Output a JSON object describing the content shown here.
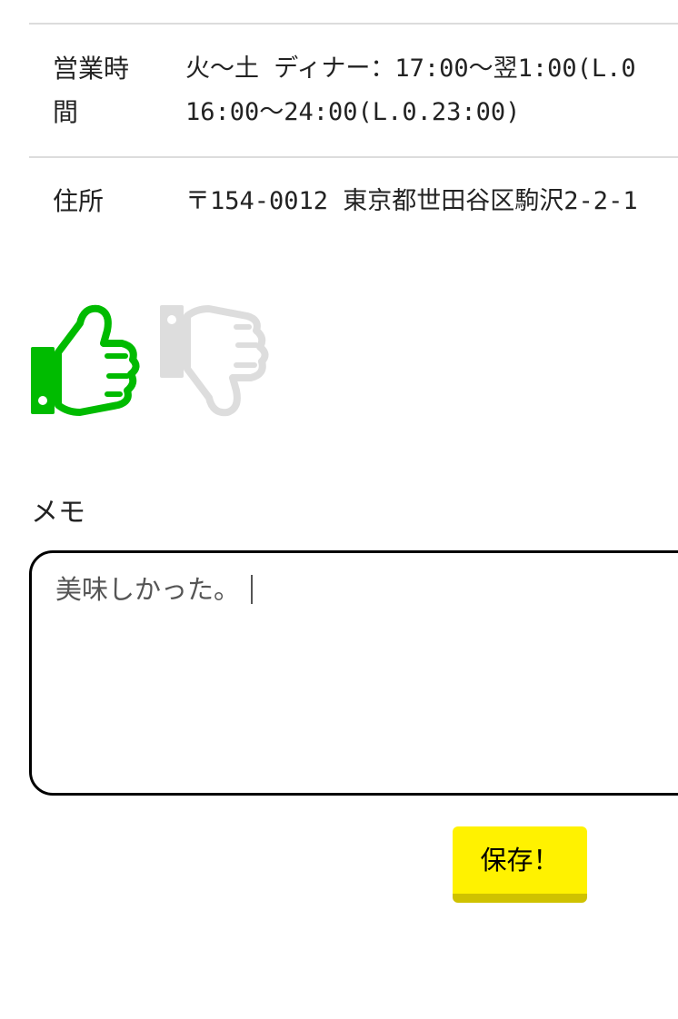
{
  "info": {
    "hours": {
      "label": "営業時間",
      "line1": "火〜土 ディナー：17:00〜翌1:00(L.0",
      "line2": "16:00〜24:00(L.0.23:00)"
    },
    "address": {
      "label": "住所",
      "value": "〒154-0012 東京都世田谷区駒沢2-2-1"
    }
  },
  "rating": {
    "like_icon": "thumbs-up-icon",
    "dislike_icon": "thumbs-down-icon",
    "like_color": "#00bb00",
    "dislike_color": "#dddddd",
    "selected": "like"
  },
  "memo": {
    "label": "メモ",
    "value": "美味しかった。"
  },
  "save": {
    "label": "保存！",
    "color": "#fff200"
  }
}
